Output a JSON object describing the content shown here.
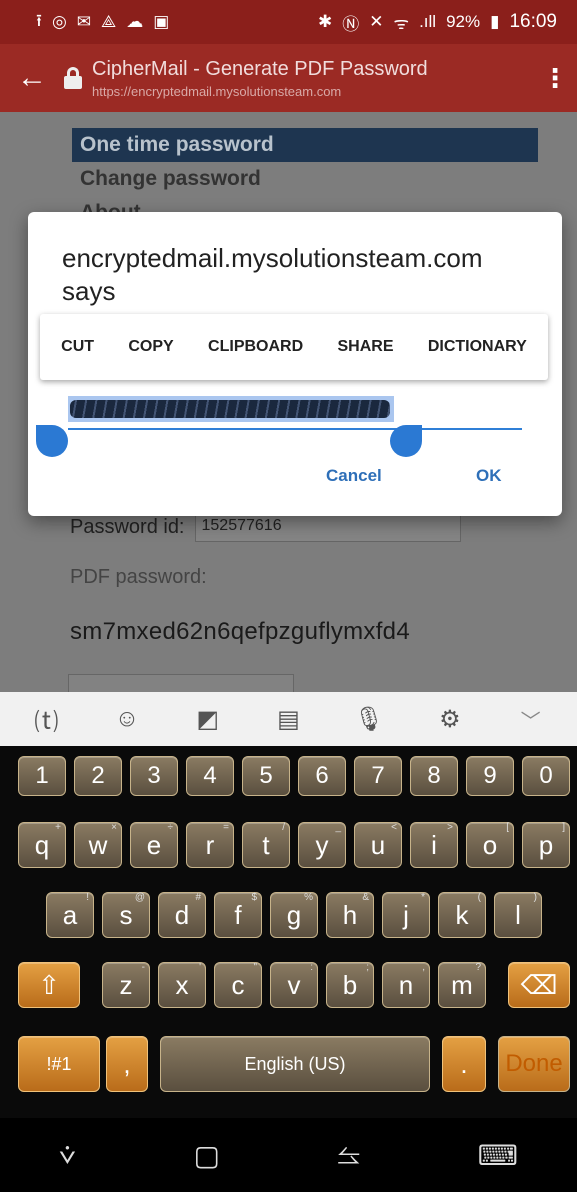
{
  "status_bar": {
    "left_icons": [
      "upload-icon",
      "alarm-icon",
      "mail-icon",
      "drive-icon",
      "cloud-icon",
      "image-icon"
    ],
    "left_glyphs": [
      "⭱",
      "◎",
      "✉",
      "⟁",
      "☁",
      "▣"
    ],
    "right_glyphs": [
      "✱",
      "Ⓝ",
      "✕",
      "ᯤ",
      ".ıll"
    ],
    "battery": "92%",
    "time": "16:09"
  },
  "app_bar": {
    "title": "CipherMail - Generate PDF Password",
    "url": "https://encryptedmail.mysolutionsteam.com"
  },
  "page": {
    "nav_items": [
      "One time password",
      "Change password",
      "About"
    ],
    "password_id_label": "Password id:",
    "password_id_value": "152577616",
    "pdf_password_label": "PDF password:",
    "pdf_password_value": "sm7mxed62n6qefpzguflymxfd4"
  },
  "dialog": {
    "title": "encryptedmail.mysolutionsteam.com says",
    "context_menu": [
      "CUT",
      "COPY",
      "CLIPBOARD",
      "SHARE",
      "DICTIONARY"
    ],
    "cancel": "Cancel",
    "ok": "OK"
  },
  "keyboard_toolbar": {
    "icons": [
      "text-mode-icon",
      "emoji-icon",
      "sticker-icon",
      "clipboard-icon",
      "microphone-icon",
      "settings-icon",
      "collapse-icon"
    ]
  },
  "keyboard": {
    "numbers": [
      "1",
      "2",
      "3",
      "4",
      "5",
      "6",
      "7",
      "8",
      "9",
      "0"
    ],
    "row1": [
      "q",
      "w",
      "e",
      "r",
      "t",
      "y",
      "u",
      "i",
      "o",
      "p"
    ],
    "row1_hints": [
      "+",
      "×",
      "÷",
      "=",
      "/",
      "_",
      "<",
      ">",
      "[",
      "]"
    ],
    "row2": [
      "a",
      "s",
      "d",
      "f",
      "g",
      "h",
      "j",
      "k",
      "l"
    ],
    "row2_hints": [
      "!",
      "@",
      "#",
      "$",
      "%",
      "&",
      "*",
      "(",
      ")"
    ],
    "row3": [
      "z",
      "x",
      "c",
      "v",
      "b",
      "n",
      "m"
    ],
    "row3_hints": [
      "-",
      "'",
      "\"",
      ":",
      ";",
      ",",
      "?"
    ],
    "symbols_key": "!#1",
    "comma_key": ",",
    "space_key": "English (US)",
    "period_key": ".",
    "done_key": "Done"
  },
  "nav_bar": {
    "icons": [
      "back-gesture-icon",
      "home-icon",
      "recents-icon",
      "keyboard-switch-icon"
    ]
  }
}
